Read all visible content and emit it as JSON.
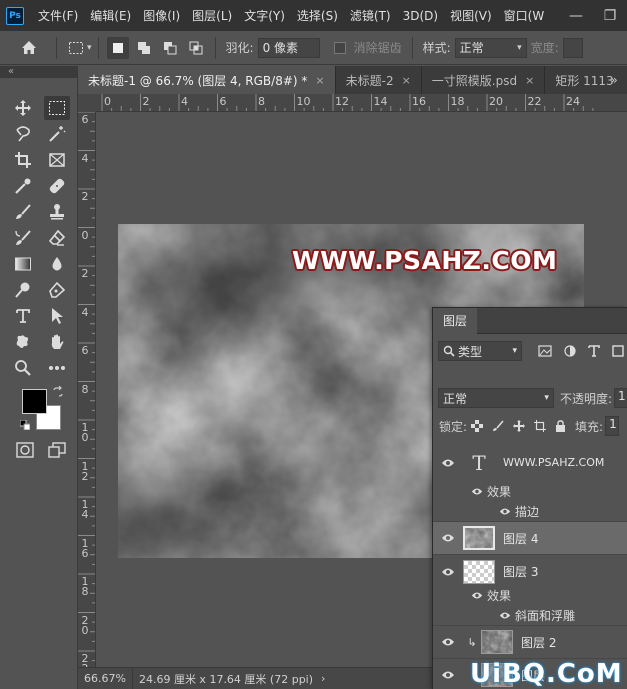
{
  "app": {
    "logo": "Ps"
  },
  "menu": [
    "文件(F)",
    "编辑(E)",
    "图像(I)",
    "图层(L)",
    "文字(Y)",
    "选择(S)",
    "滤镜(T)",
    "3D(D)",
    "视图(V)",
    "窗口(W"
  ],
  "window_controls": {
    "minimize": "—",
    "restore": "❐"
  },
  "options": {
    "feather_label": "羽化:",
    "feather_value": "0 像素",
    "antialias_label": "消除锯齿",
    "style_label": "样式:",
    "style_value": "正常",
    "width_label": "宽度:"
  },
  "tabs": [
    {
      "label": "未标题-1 @ 66.7% (图层 4, RGB/8#) *",
      "active": true,
      "close": "×"
    },
    {
      "label": "未标题-2",
      "active": false,
      "close": "×"
    },
    {
      "label": "一寸照模版.psd",
      "active": false,
      "close": "×"
    },
    {
      "label": "矩形 1113",
      "active": false,
      "close": ""
    }
  ],
  "tab_overflow": "»",
  "toolbar_collapse": "«",
  "ruler": {
    "horizontal": [
      "0",
      "2",
      "4",
      "6",
      "8",
      "10",
      "12",
      "14",
      "16",
      "18",
      "20",
      "22",
      "24"
    ],
    "vertical": [
      "6",
      "4",
      "2",
      "0",
      "2",
      "4",
      "6",
      "8",
      "10",
      "12",
      "14",
      "16",
      "18",
      "20",
      "22"
    ]
  },
  "document": {
    "text_layer_content": "WWW.PSAHZ.COM",
    "colors": {
      "stroke": "#8b1a1a",
      "fill": "#ffffff"
    }
  },
  "status": {
    "zoom": "66.67%",
    "doc_info": "24.69 厘米 x 17.64 厘米 (72 ppi)",
    "arrow": "›"
  },
  "layers_panel": {
    "tab_label": "图层",
    "filter_label": "类型",
    "blend_mode": "正常",
    "opacity_label": "不透明度:",
    "opacity_value": "1",
    "lock_label": "锁定:",
    "fill_label": "填充:",
    "fill_value": "1",
    "text_layer_glyph": "T",
    "link_glyph": "↳",
    "layers": [
      {
        "name": "WWW.PSAHZ.COM",
        "type": "text",
        "effects_label": "效果",
        "effects": [
          "描边"
        ]
      },
      {
        "name": "图层 4",
        "type": "clouds",
        "selected": true
      },
      {
        "name": "图层 3",
        "type": "transparent",
        "effects_label": "效果",
        "effects": [
          "斜面和浮雕"
        ]
      },
      {
        "name": "图层 2",
        "type": "clouds",
        "clipped": true
      },
      {
        "name": "图层",
        "type": "clouds"
      }
    ]
  },
  "watermark": "UiBQ.CoM"
}
